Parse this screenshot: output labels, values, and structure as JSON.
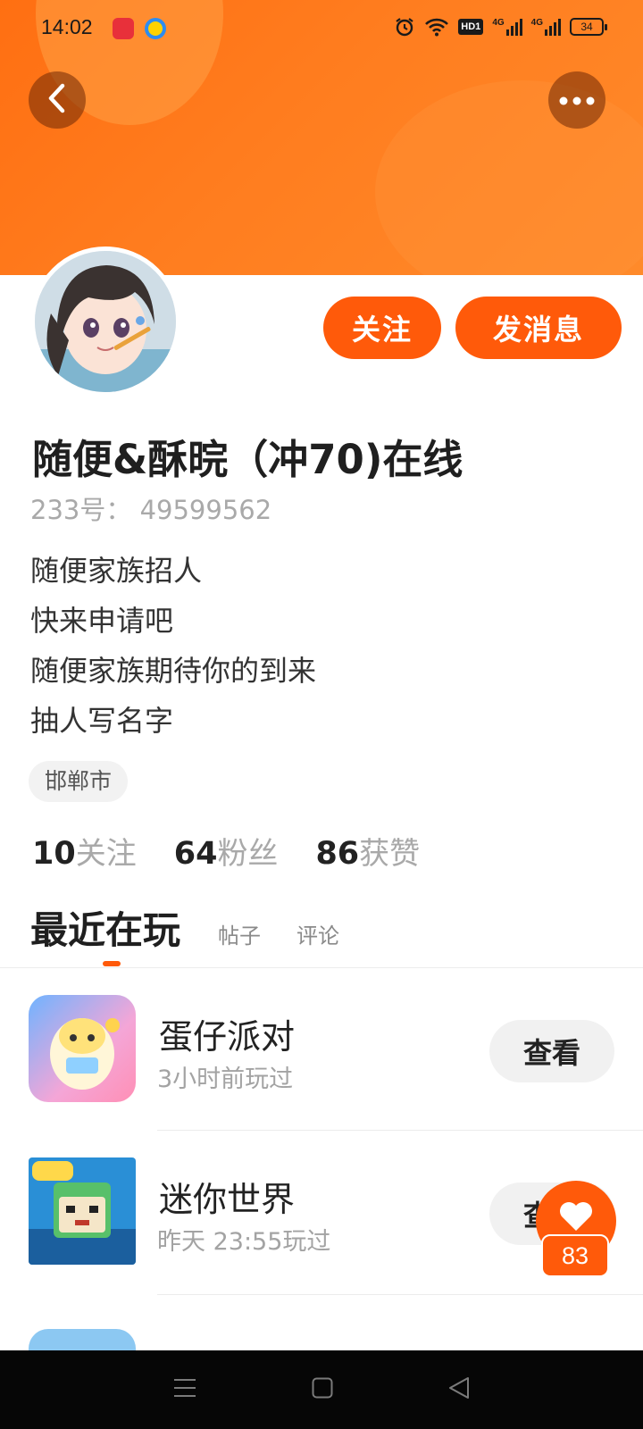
{
  "status_bar": {
    "time": "14:02",
    "battery": "34",
    "network_labels": [
      "HD1",
      "4G",
      "4G"
    ]
  },
  "header": {
    "back_icon": "chevron-left-icon",
    "more_icon": "more-horizontal-icon",
    "banner_color": "#ff7518"
  },
  "profile": {
    "nickname": "随便&酥晥（冲70)在线",
    "uid": "233号： 49599562",
    "follow_label": "关注",
    "message_label": "发消息",
    "bio_lines": [
      "随便家族招人",
      "快来申请吧",
      "随便家族期待你的到来",
      "抽人写名字"
    ],
    "location": "邯郸市",
    "stats": [
      {
        "value": "10",
        "label": "关注"
      },
      {
        "value": "64",
        "label": "粉丝"
      },
      {
        "value": "86",
        "label": "获赞"
      }
    ]
  },
  "tabs": [
    {
      "label": "最近在玩",
      "active": true
    },
    {
      "label": "帖子",
      "active": false
    },
    {
      "label": "评论",
      "active": false
    }
  ],
  "games": [
    {
      "name": "蛋仔派对",
      "played": "3小时前玩过",
      "action": "查看"
    },
    {
      "name": "迷你世界",
      "played": "昨天 23:55玩过",
      "action": "查看"
    }
  ],
  "like_fab": {
    "count": "83",
    "icon": "heart-icon"
  },
  "accent_color": "#ff5a0a"
}
